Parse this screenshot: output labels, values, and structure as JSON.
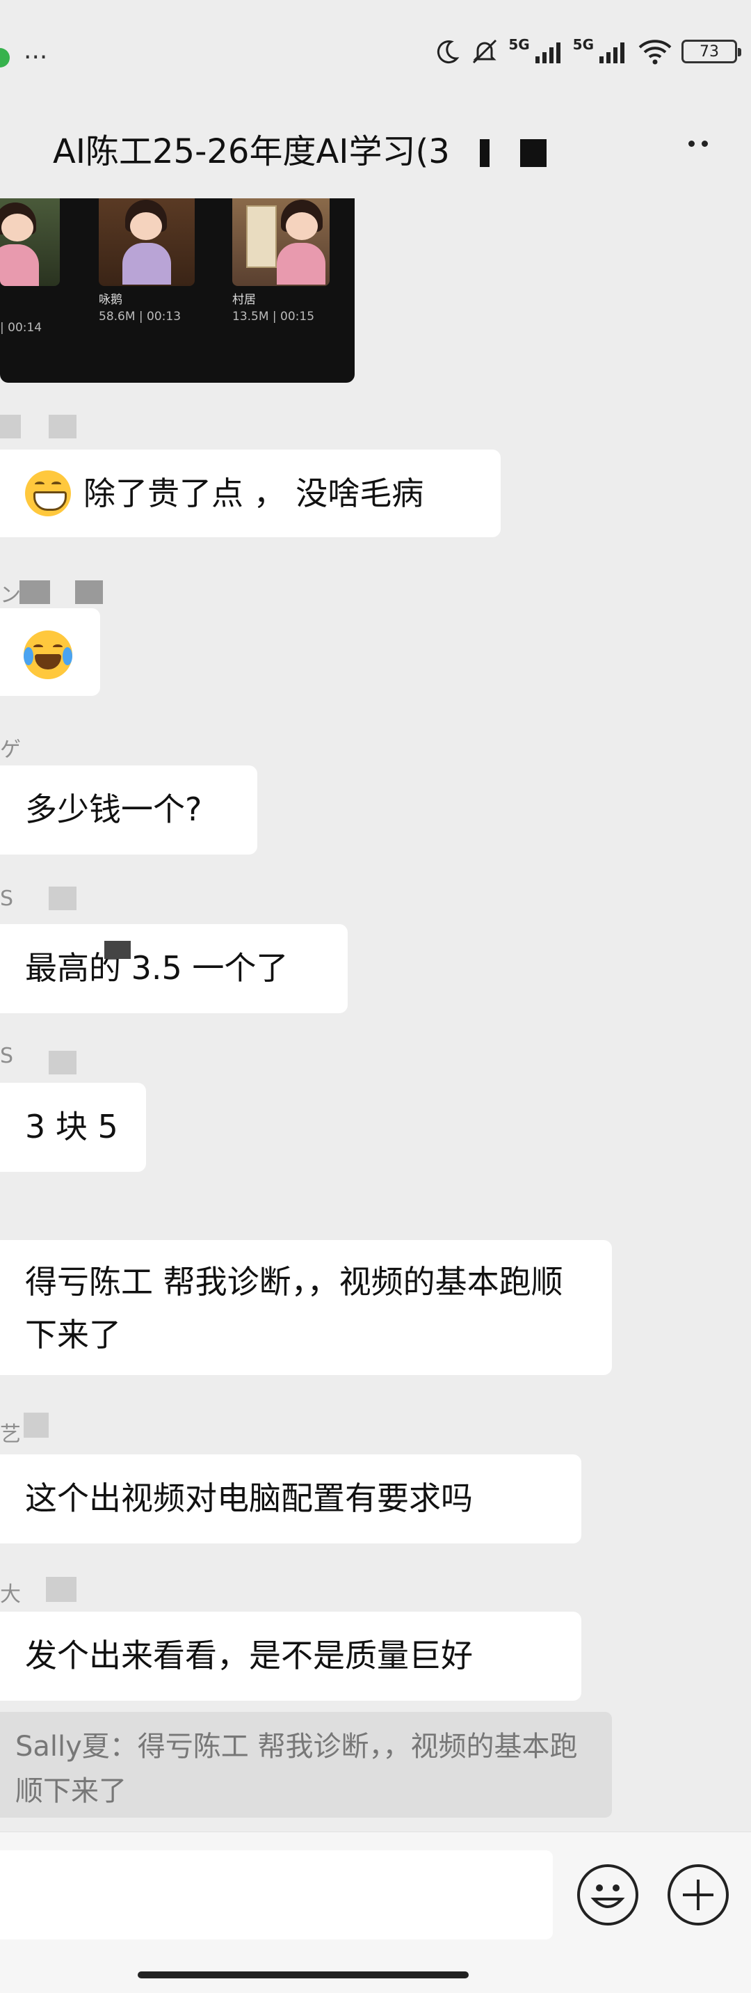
{
  "status_bar": {
    "left_dots": "···",
    "network_1": "5G",
    "network_2": "5G",
    "battery": "73"
  },
  "header": {
    "title": "AI陈工25-26年度AI学习(3",
    "more_icon": "more-horizontal-icon"
  },
  "video_card": {
    "items": [
      {
        "name": "",
        "meta": "| 00:14"
      },
      {
        "name": "咏鹅",
        "meta": "58.6M | 00:13"
      },
      {
        "name": "村居",
        "meta": "13.5M | 00:15"
      }
    ]
  },
  "messages": [
    {
      "sender": "",
      "text": "除了贵了点 ， 没啥毛病",
      "emoji": "grin-icon"
    },
    {
      "sender": "ン",
      "text": "",
      "emoji": "tears-of-joy-icon"
    },
    {
      "sender": "ゲ",
      "text": "多少钱一个?"
    },
    {
      "sender": "S",
      "text": "最高的 3.5 一个了"
    },
    {
      "sender": "S",
      "text": "3 块 5"
    },
    {
      "sender": "",
      "text": "得亏陈工 帮我诊断，，视频的基本跑顺下来了"
    },
    {
      "sender": "艺",
      "text": "这个出视频对电脑配置有要求吗"
    },
    {
      "sender": "大",
      "text": "发个出来看看，是不是质量巨好"
    }
  ],
  "quote": {
    "text": "Sally夏：得亏陈工 帮我诊断，，视频的基本跑顺下来了"
  },
  "input_bar": {
    "placeholder": "",
    "emoji_button_icon": "smiley-icon",
    "plus_button_icon": "plus-icon"
  }
}
